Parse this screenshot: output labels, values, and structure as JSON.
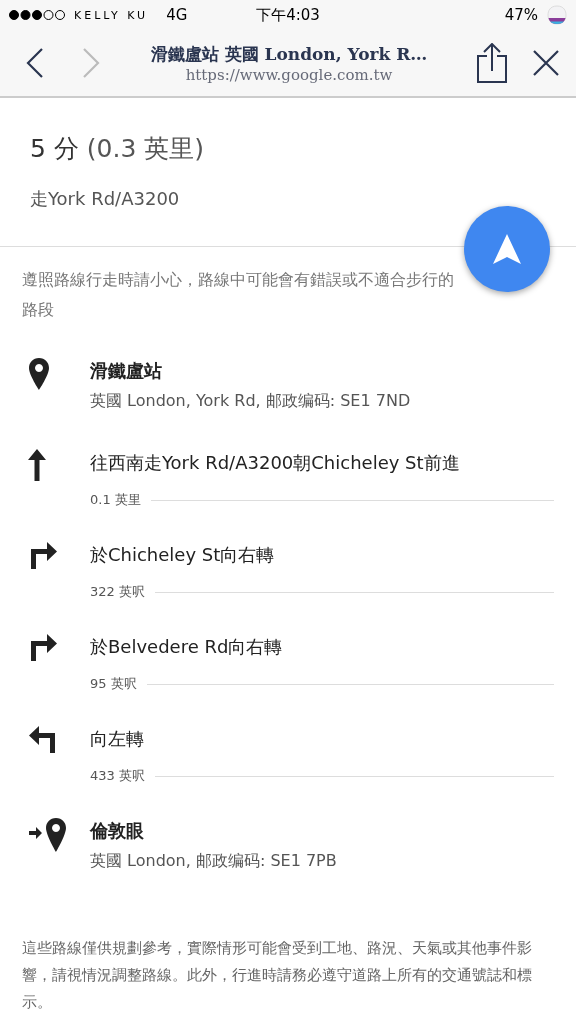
{
  "status_bar": {
    "carrier": "KELLY KU",
    "network": "4G",
    "time": "下午4:03",
    "battery": "47%"
  },
  "nav": {
    "title": "滑鐵盧站 英國 London, York R…",
    "url": "https://www.google.com.tw",
    "back_disabled": false,
    "forward_disabled": true
  },
  "summary": {
    "duration": "5 分",
    "distance": "(0.3 英里)",
    "via": "走York Rd/A3200"
  },
  "warning": "遵照路線行走時請小心，路線中可能會有錯誤或不適合步行的路段",
  "steps": [
    {
      "kind": "place",
      "title": "滑鐵盧站",
      "detail": "英國 London, York Rd, 邮政编码: SE1 7ND"
    },
    {
      "kind": "straight",
      "title": "往西南走York Rd/A3200朝Chicheley St前進",
      "distance": "0.1 英里"
    },
    {
      "kind": "right",
      "title": "於Chicheley St向右轉",
      "distance": "322 英呎"
    },
    {
      "kind": "right",
      "title": "於Belvedere Rd向右轉",
      "distance": "95 英呎"
    },
    {
      "kind": "left",
      "title": "向左轉",
      "distance": "433 英呎"
    },
    {
      "kind": "destination",
      "title": "倫敦眼",
      "detail": "英國 London, 邮政编码: SE1 7PB"
    }
  ],
  "footer": "這些路線僅供規劃參考，實際情形可能會受到工地、路況、天氣或其他事件影響，請視情況調整路線。此外，行進時請務必遵守道路上所有的交通號誌和標示。"
}
